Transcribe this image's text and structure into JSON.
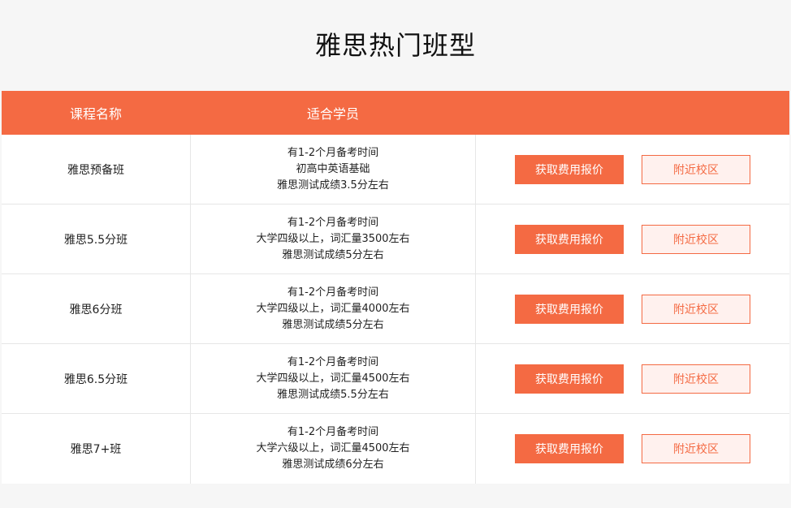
{
  "title": "雅思热门班型",
  "table": {
    "headers": {
      "name": "课程名称",
      "suit": "适合学员"
    },
    "quote_label": "获取费用报价",
    "campus_label": "附近校区",
    "rows": [
      {
        "name": "雅思预备班",
        "lines": [
          "有1-2个月备考时间",
          "初高中英语基础",
          "雅思测试成绩3.5分左右"
        ]
      },
      {
        "name": "雅思5.5分班",
        "lines": [
          "有1-2个月备考时间",
          "大学四级以上，词汇量3500左右",
          "雅思测试成绩5分左右"
        ]
      },
      {
        "name": "雅思6分班",
        "lines": [
          "有1-2个月备考时间",
          "大学四级以上，词汇量4000左右",
          "雅思测试成绩5分左右"
        ]
      },
      {
        "name": "雅思6.5分班",
        "lines": [
          "有1-2个月备考时间",
          "大学四级以上，词汇量4500左右",
          "雅思测试成绩5.5分左右"
        ]
      },
      {
        "name": "雅思7+班",
        "lines": [
          "有1-2个月备考时间",
          "大学六级以上，词汇量4500左右",
          "雅思测试成绩6分左右"
        ]
      }
    ]
  },
  "colors": {
    "accent": "#f46a43",
    "campus_bg": "#fff1ee"
  }
}
